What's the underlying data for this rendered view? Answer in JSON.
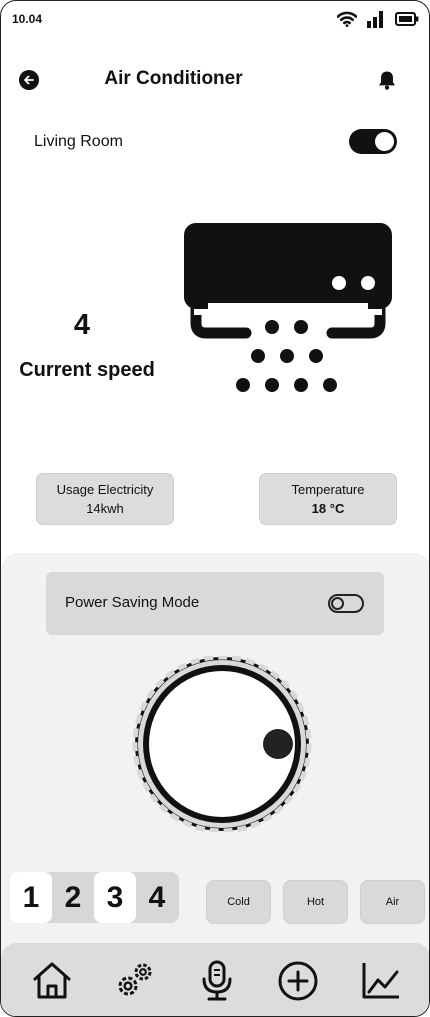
{
  "status_bar": {
    "time": "10.04",
    "icons": [
      "wifi-icon",
      "signal-icon",
      "battery-icon"
    ]
  },
  "header": {
    "title": "Air Conditioner",
    "back_icon": "back-arrow-icon",
    "notification_icon": "bell-icon"
  },
  "room": {
    "label": "Living Room",
    "power_on": true
  },
  "speed": {
    "value": "4",
    "label": "Current speed"
  },
  "info": {
    "usage_label": "Usage Electricity",
    "usage_value": "14kwh",
    "temp_label": "Temperature",
    "temp_value": "18",
    "temp_unit": "°C"
  },
  "power_saving": {
    "label": "Power Saving Mode",
    "enabled": false
  },
  "speed_selector": {
    "options": [
      "1",
      "2",
      "3",
      "4"
    ],
    "highlighted": [
      "1",
      "3"
    ]
  },
  "modes": {
    "cold": "Cold",
    "hot": "Hot",
    "air": "Air"
  },
  "nav": {
    "items": [
      "home-icon",
      "settings-icon",
      "microphone-icon",
      "add-icon",
      "chart-icon"
    ]
  },
  "colors": {
    "primary": "#111111",
    "panel": "#f2f2f2",
    "card": "#dcdcdc"
  }
}
